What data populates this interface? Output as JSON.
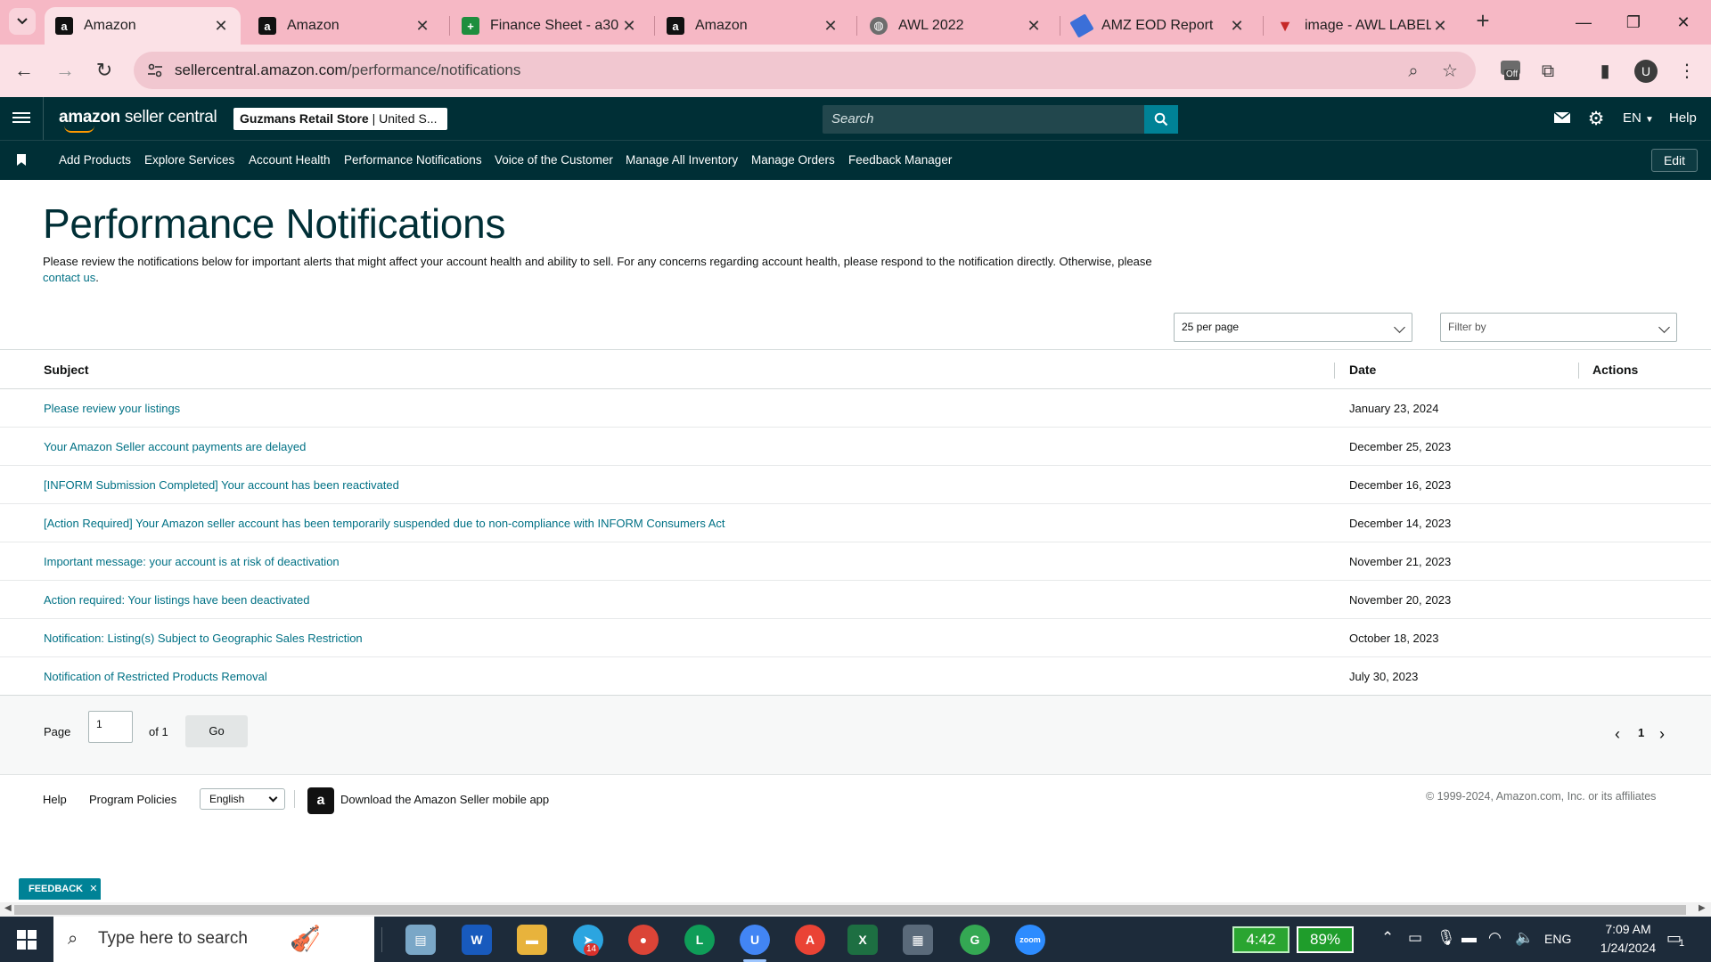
{
  "browser": {
    "tabs": [
      {
        "title": "Amazon",
        "favicon": "amazon-icon",
        "active": true
      },
      {
        "title": "Amazon",
        "favicon": "amazon-icon",
        "active": false
      },
      {
        "title": "Finance Sheet - a30",
        "favicon": "google-sheets-icon",
        "active": false
      },
      {
        "title": "Amazon",
        "favicon": "amazon-icon",
        "active": false
      },
      {
        "title": "AWL 2022",
        "favicon": "globe-icon",
        "active": false
      },
      {
        "title": "AMZ EOD Report",
        "favicon": "report-icon",
        "active": false
      },
      {
        "title": "image - AWL LABEL",
        "favicon": "label-icon",
        "active": false
      }
    ],
    "url_host": "sellercentral.amazon.com",
    "url_path": "/performance/notifications",
    "profile_initial": "U",
    "extension_badge": "Off"
  },
  "header": {
    "logo_bold": "amazon",
    "logo_rest": " seller central",
    "store_name": "Guzmans Retail Store",
    "store_region": " | United S...",
    "search_placeholder": "Search",
    "language": "EN",
    "help": "Help"
  },
  "nav": {
    "items": [
      "Add Products",
      "Explore Services",
      "Account Health",
      "Performance Notifications",
      "Voice of the Customer",
      "Manage All Inventory",
      "Manage Orders",
      "Feedback Manager"
    ],
    "edit": "Edit"
  },
  "main": {
    "title": "Performance Notifications",
    "intro_text": "Please review the notifications below for important alerts that might affect your account health and ability to sell. For any concerns regarding account health, please respond to the notification directly. Otherwise, please ",
    "intro_link": "contact us",
    "intro_end": ".",
    "per_page": "25 per page",
    "filter_placeholder": "Filter by",
    "columns": {
      "subject": "Subject",
      "date": "Date",
      "actions": "Actions"
    },
    "rows": [
      {
        "subject": "Please review your listings",
        "date": "January 23, 2024"
      },
      {
        "subject": "Your Amazon Seller account payments are delayed",
        "date": "December 25, 2023"
      },
      {
        "subject": "[INFORM Submission Completed] Your account has been reactivated",
        "date": "December 16, 2023"
      },
      {
        "subject": "[Action Required] Your Amazon seller account has been temporarily suspended due to non-compliance with INFORM Consumers Act",
        "date": "December 14, 2023"
      },
      {
        "subject": "Important message: your account is at risk of deactivation",
        "date": "November 21, 2023"
      },
      {
        "subject": "Action required: Your listings have been deactivated",
        "date": "November 20, 2023"
      },
      {
        "subject": "Notification: Listing(s) Subject to Geographic Sales Restriction",
        "date": "October 18, 2023"
      },
      {
        "subject": "Notification of Restricted Products Removal",
        "date": "July 30, 2023"
      }
    ],
    "pagination": {
      "page_label": "Page",
      "page_value": "1",
      "of_label": "of 1",
      "go": "Go",
      "current_page": "1"
    }
  },
  "footer": {
    "help": "Help",
    "program_policies": "Program Policies",
    "language": "English",
    "download_app": "Download the Amazon Seller mobile app",
    "copyright": "© 1999-2024, Amazon.com, Inc. or its affiliates",
    "feedback": "FEEDBACK"
  },
  "taskbar": {
    "search_placeholder": "Type here to search",
    "telegram_badge": "14",
    "timer": "4:42",
    "battery": "89%",
    "language": "ENG",
    "time": "7:09 AM",
    "date": "1/24/2024",
    "notifications": "1"
  },
  "colors": {
    "header_bg": "#002f36",
    "link": "#007185",
    "accent": "#008296",
    "tabbar_bg": "#f6b8c5"
  }
}
